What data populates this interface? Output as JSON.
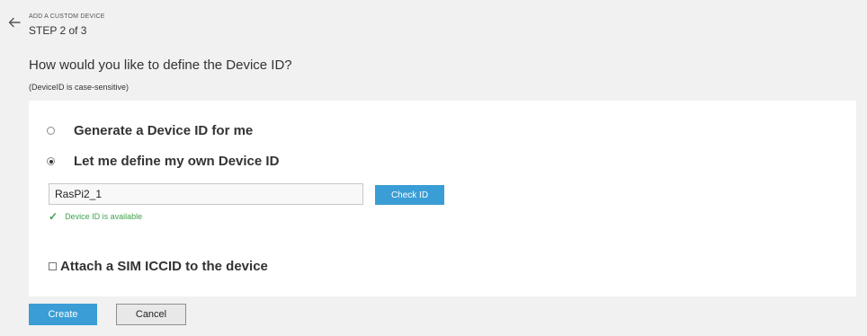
{
  "header": {
    "back_icon": "arrow-left-icon",
    "overline": "ADD A CUSTOM DEVICE",
    "step": "STEP 2 of 3"
  },
  "main": {
    "question": "How would you like to define the Device ID?",
    "note": "(DeviceID is case-sensitive)"
  },
  "options": {
    "generate": {
      "label": "Generate a Device ID for me",
      "checked": false
    },
    "define": {
      "label": "Let me define my own Device ID",
      "checked": true
    }
  },
  "device_id": {
    "value": "RasPi2_1",
    "check_label": "Check ID",
    "status_icon": "checkmark-icon",
    "status_symbol": "✓",
    "status_text": "Device ID is available",
    "status_color": "#3fa34d"
  },
  "sim": {
    "label": "Attach a SIM ICCID to the device",
    "checked": false
  },
  "footer": {
    "create_label": "Create",
    "cancel_label": "Cancel"
  },
  "colors": {
    "accent": "#3a9dd6",
    "background": "#f1f1f1",
    "panel": "#ffffff"
  }
}
